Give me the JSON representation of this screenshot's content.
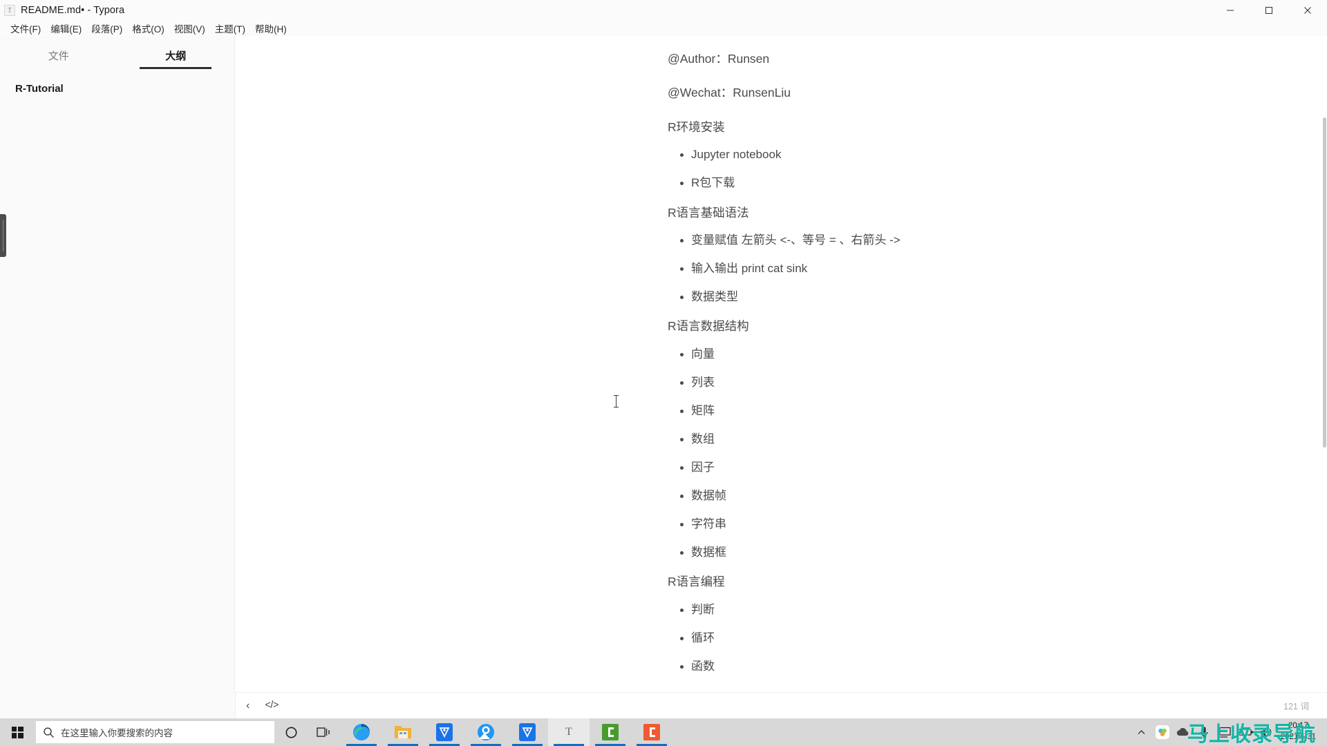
{
  "window": {
    "app_icon": "T",
    "title": "README.md• - Typora",
    "controls": {
      "minimize": "minimize-icon",
      "maximize": "maximize-icon",
      "close": "close-icon"
    }
  },
  "menubar": {
    "items": [
      {
        "label": "文件(F)",
        "name": "menu-file"
      },
      {
        "label": "编辑(E)",
        "name": "menu-edit"
      },
      {
        "label": "段落(P)",
        "name": "menu-paragraph"
      },
      {
        "label": "格式(O)",
        "name": "menu-format"
      },
      {
        "label": "视图(V)",
        "name": "menu-view"
      },
      {
        "label": "主题(T)",
        "name": "menu-theme"
      },
      {
        "label": "帮助(H)",
        "name": "menu-help"
      }
    ]
  },
  "sidebar": {
    "tabs": [
      {
        "label": "文件",
        "active": false
      },
      {
        "label": "大纲",
        "active": true
      }
    ],
    "outline": [
      {
        "label": "R-Tutorial",
        "level": 1
      }
    ]
  },
  "document": {
    "blocks": [
      {
        "type": "paragraph",
        "text": "@Author：Runsen"
      },
      {
        "type": "paragraph",
        "text": "@Wechat：RunsenLiu"
      },
      {
        "type": "paragraph",
        "text": "R环境安装"
      },
      {
        "type": "list",
        "items": [
          "Jupyter notebook",
          "R包下载"
        ]
      },
      {
        "type": "paragraph",
        "text": "R语言基础语法"
      },
      {
        "type": "list",
        "items": [
          "变量赋值 左箭头 <-、等号 = 、右箭头 ->",
          "输入输出  print  cat sink",
          "数据类型"
        ]
      },
      {
        "type": "paragraph",
        "text": "R语言数据结构"
      },
      {
        "type": "list",
        "items": [
          "向量",
          "列表",
          "矩阵",
          "数组",
          "因子",
          "数据帧",
          "字符串",
          "数据框"
        ]
      },
      {
        "type": "paragraph",
        "text": "R语言编程"
      },
      {
        "type": "list",
        "items": [
          "判断",
          "循环",
          "函数"
        ]
      }
    ]
  },
  "statusbar": {
    "sidebar_toggle": "‹",
    "source_code_toggle": "</>",
    "word_count": "121 词"
  },
  "taskbar": {
    "start": "windows-logo-icon",
    "search_placeholder": "在这里输入你要搜索的内容",
    "cortana": "cortana-circle-icon",
    "task_view": "task-view-icon",
    "apps": [
      {
        "name": "edge-icon",
        "glyph": "e",
        "active": false,
        "running": true
      },
      {
        "name": "file-explorer-icon",
        "glyph": "",
        "active": false,
        "running": true
      },
      {
        "name": "shield-app-icon",
        "glyph": "",
        "active": false,
        "running": true
      },
      {
        "name": "browser-app-icon",
        "glyph": "",
        "active": false,
        "running": true
      },
      {
        "name": "shield-app-2-icon",
        "glyph": "",
        "active": false,
        "running": true
      },
      {
        "name": "typora-icon",
        "glyph": "T",
        "active": true,
        "running": true
      },
      {
        "name": "green-app-icon",
        "glyph": "C",
        "active": false,
        "running": true
      },
      {
        "name": "orange-app-icon",
        "glyph": "C",
        "active": false,
        "running": true
      }
    ],
    "tray": [
      {
        "name": "show-hidden-icons-chevron"
      },
      {
        "name": "cloud-sync-icon"
      },
      {
        "name": "onedrive-icon"
      },
      {
        "name": "microphone-icon"
      },
      {
        "name": "display-icon"
      },
      {
        "name": "battery-icon"
      },
      {
        "name": "volume-icon"
      }
    ],
    "clock": {
      "time": "20:17",
      "date": "2021/5/31"
    }
  },
  "watermark": {
    "text": "马上收录导航"
  },
  "colors": {
    "accent": "#0b6ec1",
    "taskbar": "#d8d8d8",
    "sidebar": "#fafafa",
    "text": "#4b4b4b",
    "watermark": "#13b5a6"
  }
}
